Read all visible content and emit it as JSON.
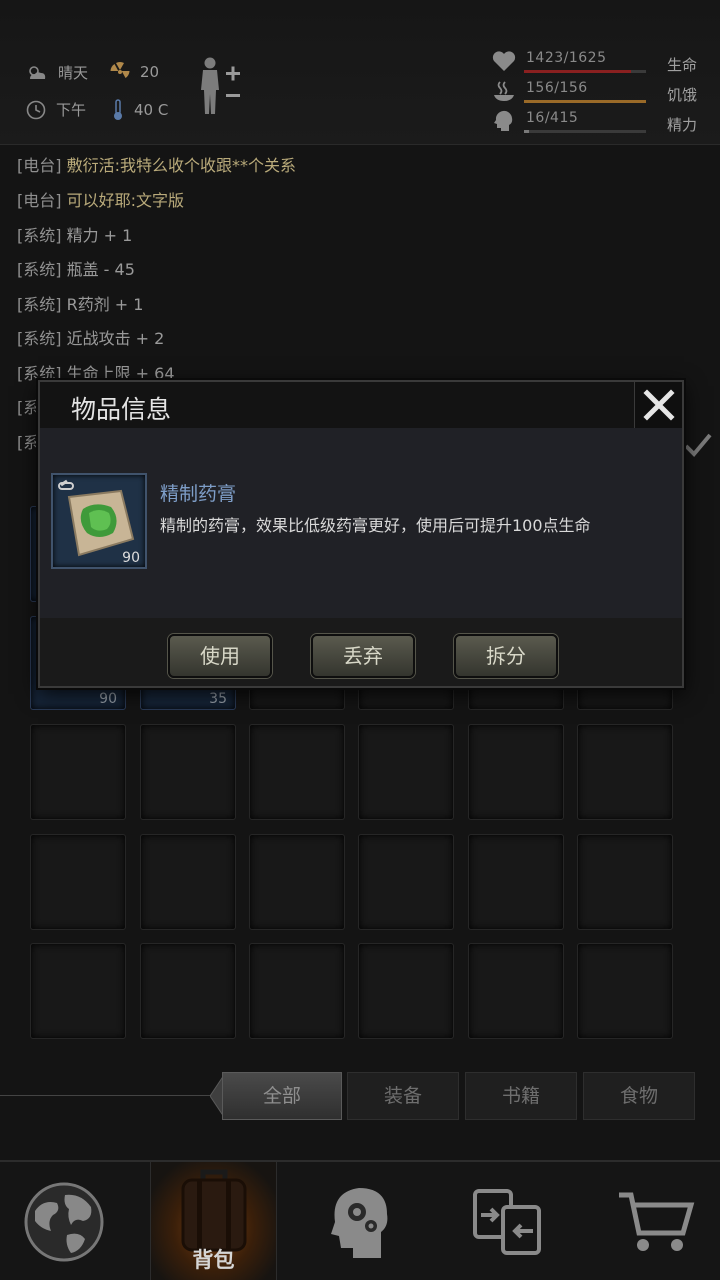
{
  "status": {
    "weather": "晴天",
    "radiation": "20",
    "time": "下午",
    "temperature": "40 C",
    "life": {
      "value": "1423/1625",
      "label": "生命",
      "fraction": 0.876,
      "color": "#8a2020"
    },
    "hunger": {
      "value": "156/156",
      "label": "饥饿",
      "fraction": 1.0,
      "color": "#9a6a28"
    },
    "energy": {
      "value": "16/415",
      "label": "精力",
      "fraction": 0.04,
      "color": "#7a7a7a"
    }
  },
  "log": [
    {
      "tag": "[电台]",
      "msg": "敷衍活:我特么收个收跟**个关系",
      "type": "radio"
    },
    {
      "tag": "[电台]",
      "msg": "可以好耶:文字版",
      "type": "radio"
    },
    {
      "tag": "[系统]",
      "msg": "精力 + 1",
      "type": "system"
    },
    {
      "tag": "[系统]",
      "msg": "瓶盖 - 45",
      "type": "system"
    },
    {
      "tag": "[系统]",
      "msg": "R药剂 + 1",
      "type": "system"
    },
    {
      "tag": "[系统]",
      "msg": "近战攻击 + 2",
      "type": "system"
    },
    {
      "tag": "[系统]",
      "msg": "生命上限 + 64",
      "type": "system"
    },
    {
      "tag": "[系",
      "msg": "",
      "type": "system"
    },
    {
      "tag": "[系",
      "msg": "",
      "type": "system"
    }
  ],
  "inventory": {
    "slot_counts": [
      "90",
      "35"
    ]
  },
  "tabs": {
    "all": "全部",
    "equipment": "装备",
    "books": "书籍",
    "food": "食物"
  },
  "nav": {
    "backpack": "背包"
  },
  "dialog": {
    "title": "物品信息",
    "item_name": "精制药膏",
    "item_desc": "精制的药膏，效果比低级药膏更好，使用后可提升100点生命",
    "item_count": "90",
    "use": "使用",
    "discard": "丢弃",
    "split": "拆分"
  }
}
